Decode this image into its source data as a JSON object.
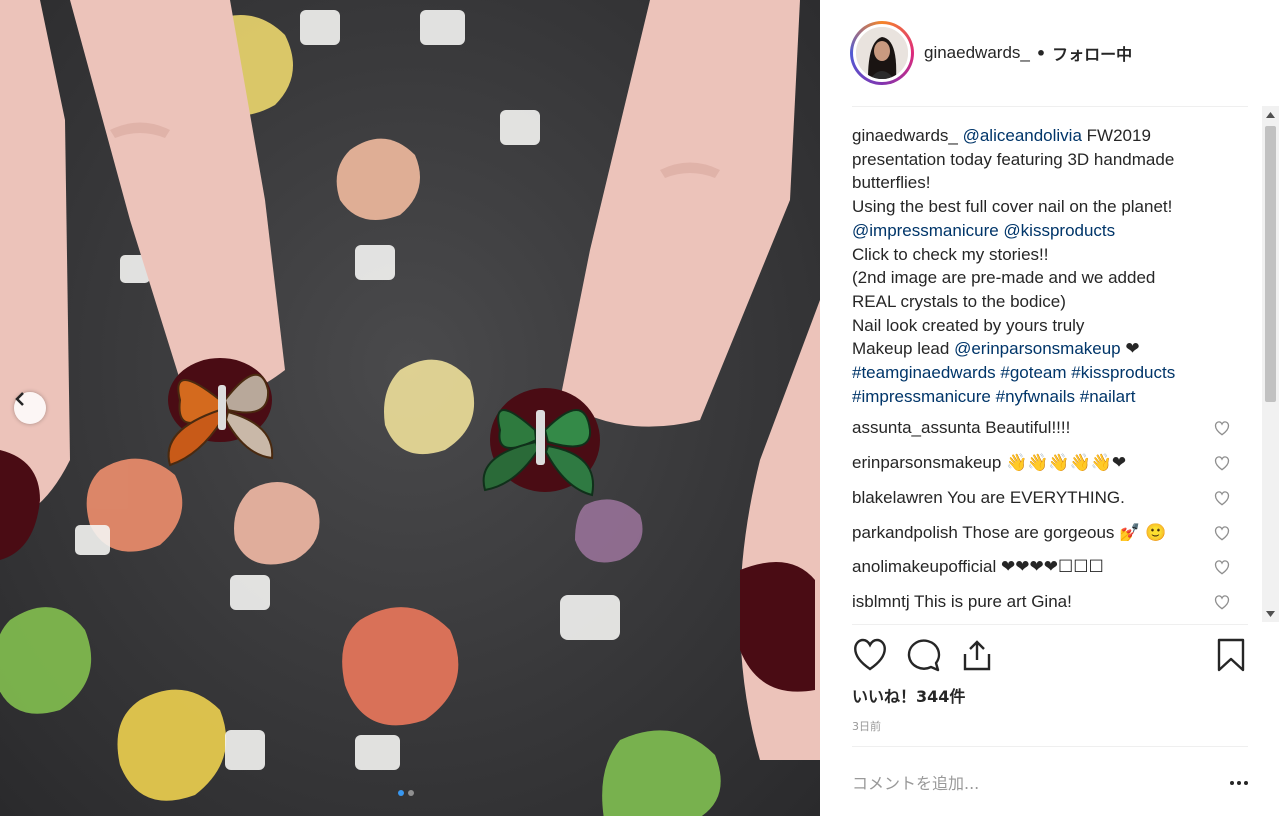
{
  "post": {
    "username": "ginaedwards_",
    "separator": "•",
    "follow_state": "フォロー中",
    "caption_lines": [
      [
        {
          "t": "ginaedwards_",
          "k": "author"
        },
        {
          "t": " "
        },
        {
          "t": "@aliceandolivia",
          "k": "link"
        },
        {
          "t": " FW2019"
        }
      ],
      [
        {
          "t": "presentation today featuring 3D handmade"
        }
      ],
      [
        {
          "t": "butterflies!"
        }
      ],
      [
        {
          "t": "Using the best full cover nail on the planet!"
        }
      ],
      [
        {
          "t": "@impressmanicure",
          "k": "link"
        },
        {
          "t": " "
        },
        {
          "t": "@kissproducts",
          "k": "link"
        }
      ],
      [
        {
          "t": "Click to check my stories!!"
        }
      ],
      [
        {
          "t": "(2nd image are pre-made and we added"
        }
      ],
      [
        {
          "t": "REAL crystals to the bodice)"
        }
      ],
      [
        {
          "t": "Nail look created by yours truly"
        }
      ],
      [
        {
          "t": "Makeup lead "
        },
        {
          "t": "@erinparsonsmakeup",
          "k": "link"
        },
        {
          "t": " ❤"
        }
      ],
      [
        {
          "t": "#teamginaedwards",
          "k": "link"
        },
        {
          "t": " "
        },
        {
          "t": "#goteam",
          "k": "link"
        },
        {
          "t": " "
        },
        {
          "t": "#kissproducts",
          "k": "link"
        }
      ],
      [
        {
          "t": "#impressmanicure",
          "k": "link"
        },
        {
          "t": " "
        },
        {
          "t": "#nyfwnails",
          "k": "link"
        },
        {
          "t": " "
        },
        {
          "t": "#nailart",
          "k": "link"
        }
      ]
    ],
    "comments": [
      {
        "user": "assunta_assunta",
        "text": "Beautiful!!!!"
      },
      {
        "user": "erinparsonsmakeup",
        "text": "👋👋👋👋👋❤"
      },
      {
        "user": "blakelawren",
        "text": "You are EVERYTHING."
      },
      {
        "user": "parkandpolish",
        "text": "Those are gorgeous 💅 🙂"
      },
      {
        "user": "anolimakeupofficial",
        "text": "❤❤❤❤☐☐☐"
      },
      {
        "user": "isblmntj",
        "text": "This is pure art Gina!"
      }
    ],
    "likes_text": "いいね！344件",
    "time_text": "3日前",
    "comment_placeholder": "コメントを追加...",
    "carousel": {
      "count": 2,
      "active": 0
    }
  },
  "icons": {
    "heart": "heart-icon",
    "comment": "comment-icon",
    "share": "share-icon",
    "save": "bookmark-icon",
    "prev": "chevron-left-icon",
    "more": "more-horizontal-icon"
  },
  "colors": {
    "link": "#003569",
    "text": "#262626",
    "muted": "#999999",
    "carousel_active": "#3897f0"
  }
}
